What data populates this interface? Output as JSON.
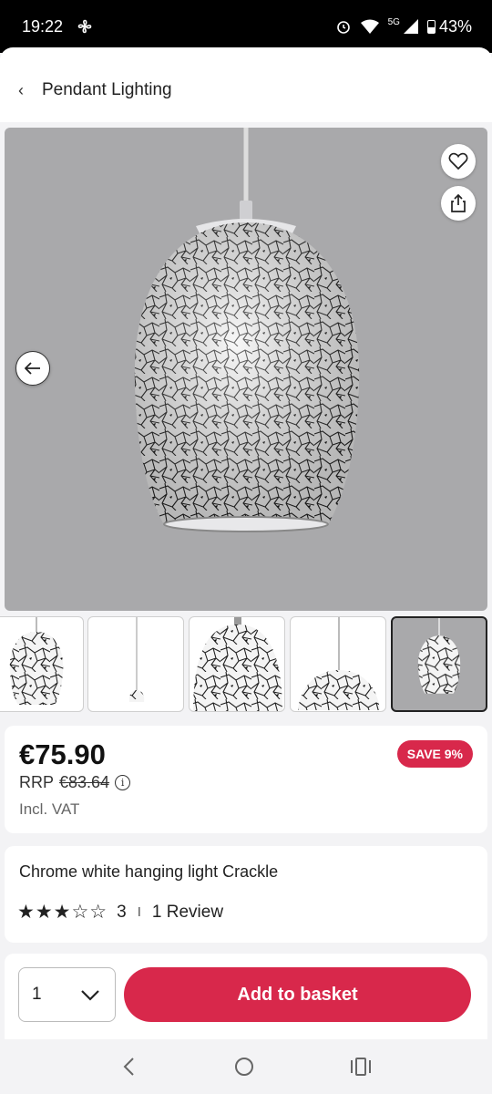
{
  "status_bar": {
    "time": "19:22",
    "network": "5G",
    "battery": "43%"
  },
  "header": {
    "title": "Pendant Lighting"
  },
  "product": {
    "price": "€75.90",
    "rrp_label": "RRP",
    "rrp_price": "€83.64",
    "vat_note": "Incl. VAT",
    "save_badge": "SAVE 9%",
    "name": "Chrome white hanging light Crackle",
    "stars_filled": "★★★",
    "stars_empty": "☆☆",
    "rating": "3",
    "separator": "I",
    "reviews": "1 Review"
  },
  "thumbnails": {
    "count": 5,
    "selected_index": 4
  },
  "purchase": {
    "quantity": "1",
    "add_label": "Add to basket"
  },
  "colors": {
    "accent": "#d8284b",
    "image_bg": "#a9a9ab"
  },
  "icons": [
    "back-chevron-icon",
    "heart-icon",
    "share-icon",
    "arrow-left-icon",
    "info-icon",
    "chevron-down-icon"
  ]
}
